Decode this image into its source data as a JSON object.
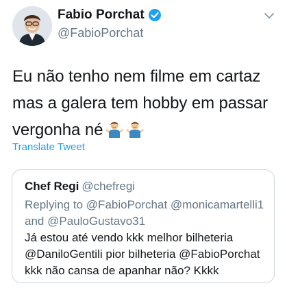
{
  "tweet": {
    "author": {
      "display_name": "Fabio Porchat",
      "handle": "@FabioPorchat",
      "verified_icon": "verified-badge-icon",
      "avatar_icon": "profile-photo"
    },
    "menu_icon": "chevron-down-icon",
    "text_lines": [
      "Eu não tenho nem filme em cartaz",
      "mas a galera tem hobby em passar",
      "vergonha né"
    ],
    "emojis": [
      "man-shrugging-emoji",
      "man-shrugging-emoji"
    ],
    "translate_label": "Translate Tweet"
  },
  "quoted_tweet": {
    "display_name": "Chef Regi",
    "handle": "@chefregi",
    "replying_prefix": "Replying to",
    "replying_mentions": [
      "@FabioPorchat",
      "@monicamartelli1",
      "@PauloGustavo31"
    ],
    "replying_and": "and",
    "body_lines": [
      "Já estou até vendo kkk melhor bilheteria",
      "@DaniloGentili  pior bilheteria @FabioPorchat",
      "kkk não cansa de apanhar não? Kkkk"
    ]
  },
  "colors": {
    "accent": "#1da1f2",
    "text": "#14171a",
    "secondary": "#657786",
    "border": "#ccd6dd"
  }
}
